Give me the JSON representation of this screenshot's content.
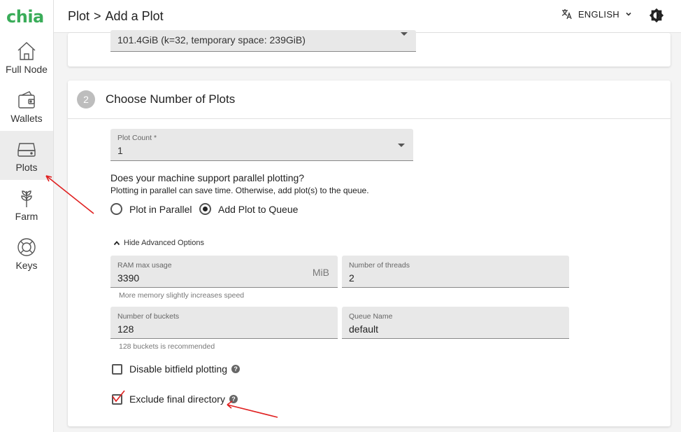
{
  "app": {
    "logo_text": "chia",
    "brand_color": "#3aac59"
  },
  "sidebar": {
    "items": [
      {
        "label": "Full Node",
        "icon": "home-icon"
      },
      {
        "label": "Wallets",
        "icon": "wallet-icon"
      },
      {
        "label": "Plots",
        "icon": "hdd-icon",
        "active": true
      },
      {
        "label": "Farm",
        "icon": "plant-icon"
      },
      {
        "label": "Keys",
        "icon": "lifebuoy-icon"
      }
    ]
  },
  "header": {
    "breadcrumb_root": "Plot",
    "breadcrumb_sep": ">",
    "breadcrumb_page": "Add a Plot",
    "language": "ENGLISH"
  },
  "plot_size": {
    "value": "101.4GiB (k=32, temporary space: 239GiB)"
  },
  "step2": {
    "number": "2",
    "title": "Choose Number of Plots",
    "plot_count": {
      "label": "Plot Count *",
      "value": "1"
    },
    "parallel_question": "Does your machine support parallel plotting?",
    "parallel_hint": "Plotting in parallel can save time. Otherwise, add plot(s) to the queue.",
    "radio_parallel": "Plot in Parallel",
    "radio_queue": "Add Plot to Queue",
    "advanced_toggle": "Hide Advanced Options",
    "ram": {
      "label": "RAM max usage",
      "value": "3390",
      "unit": "MiB",
      "helper": "More memory slightly increases speed"
    },
    "threads": {
      "label": "Number of threads",
      "value": "2"
    },
    "buckets": {
      "label": "Number of buckets",
      "value": "128",
      "helper": "128 buckets is recommended"
    },
    "queue": {
      "label": "Queue Name",
      "value": "default"
    },
    "disable_bitfield": {
      "label": "Disable bitfield plotting",
      "checked": false
    },
    "exclude_final": {
      "label": "Exclude final directory",
      "checked": true
    },
    "help_glyph": "?"
  },
  "annotation_color": "#e02020"
}
